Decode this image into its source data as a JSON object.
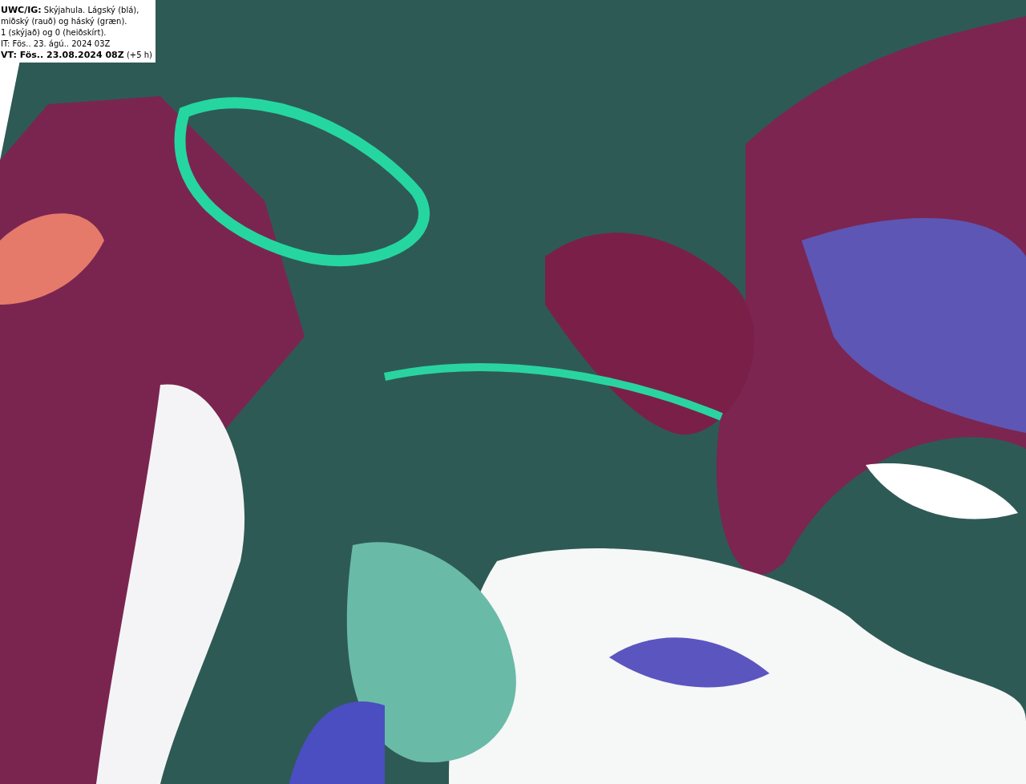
{
  "legend": {
    "lines": [
      "**UWC/IG:** Skýjahula. Lágský (blá),",
      "miðský (rauð) og háský (græn).",
      "1 (skýjað) og 0 (heiðskírt).",
      "IT: Fös.. 23. ágú.. 2024 03Z",
      "**VT: Fös.. 23.08.2024 08Z** (+5 h)"
    ]
  }
}
